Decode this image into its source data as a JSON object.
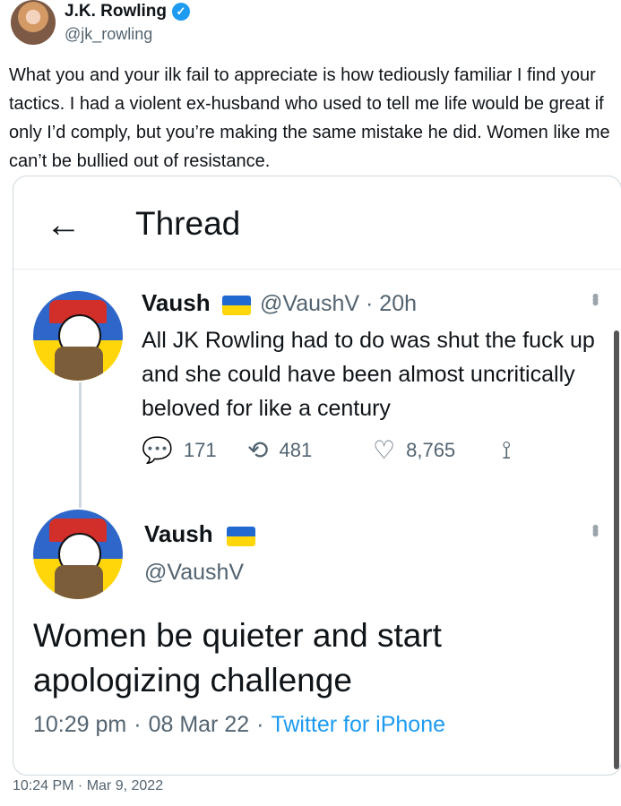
{
  "header": {
    "name": "J.K. Rowling",
    "handle": "@jk_rowling",
    "verified_mark": "✓"
  },
  "tweet": {
    "text": "What you and your ilk fail to appreciate is how tediously familiar I find your tactics. I had a violent ex-husband who used to tell me life would be great if only I’d comply, but you’re making the same mistake he did. Women like me can’t be bullied out of resistance.",
    "timestamp": "10:24 PM · Mar 9, 2022"
  },
  "quoted": {
    "thread_title": "Thread",
    "back_icon": "←",
    "reply": {
      "name": "Vaush",
      "handle_time": "@VaushV · 20h",
      "more_icon": "•••",
      "text": "All JK Rowling had to do was shut the fuck up and she could have been almost uncritically beloved for like a century",
      "reply_count": "171",
      "retweet_count": "481",
      "like_count": "8,765",
      "reply_icon": "💬",
      "retweet_icon": "⟲",
      "like_icon": "♡",
      "share_icon": "⟟"
    },
    "main": {
      "name": "Vaush",
      "handle": "@VaushV",
      "more_icon": "•••",
      "text": "Women be quieter and start apologizing challenge",
      "time": "10:29 pm",
      "sep1": "·",
      "date": "08 Mar 22",
      "sep2": "·",
      "source": "Twitter for iPhone"
    }
  }
}
